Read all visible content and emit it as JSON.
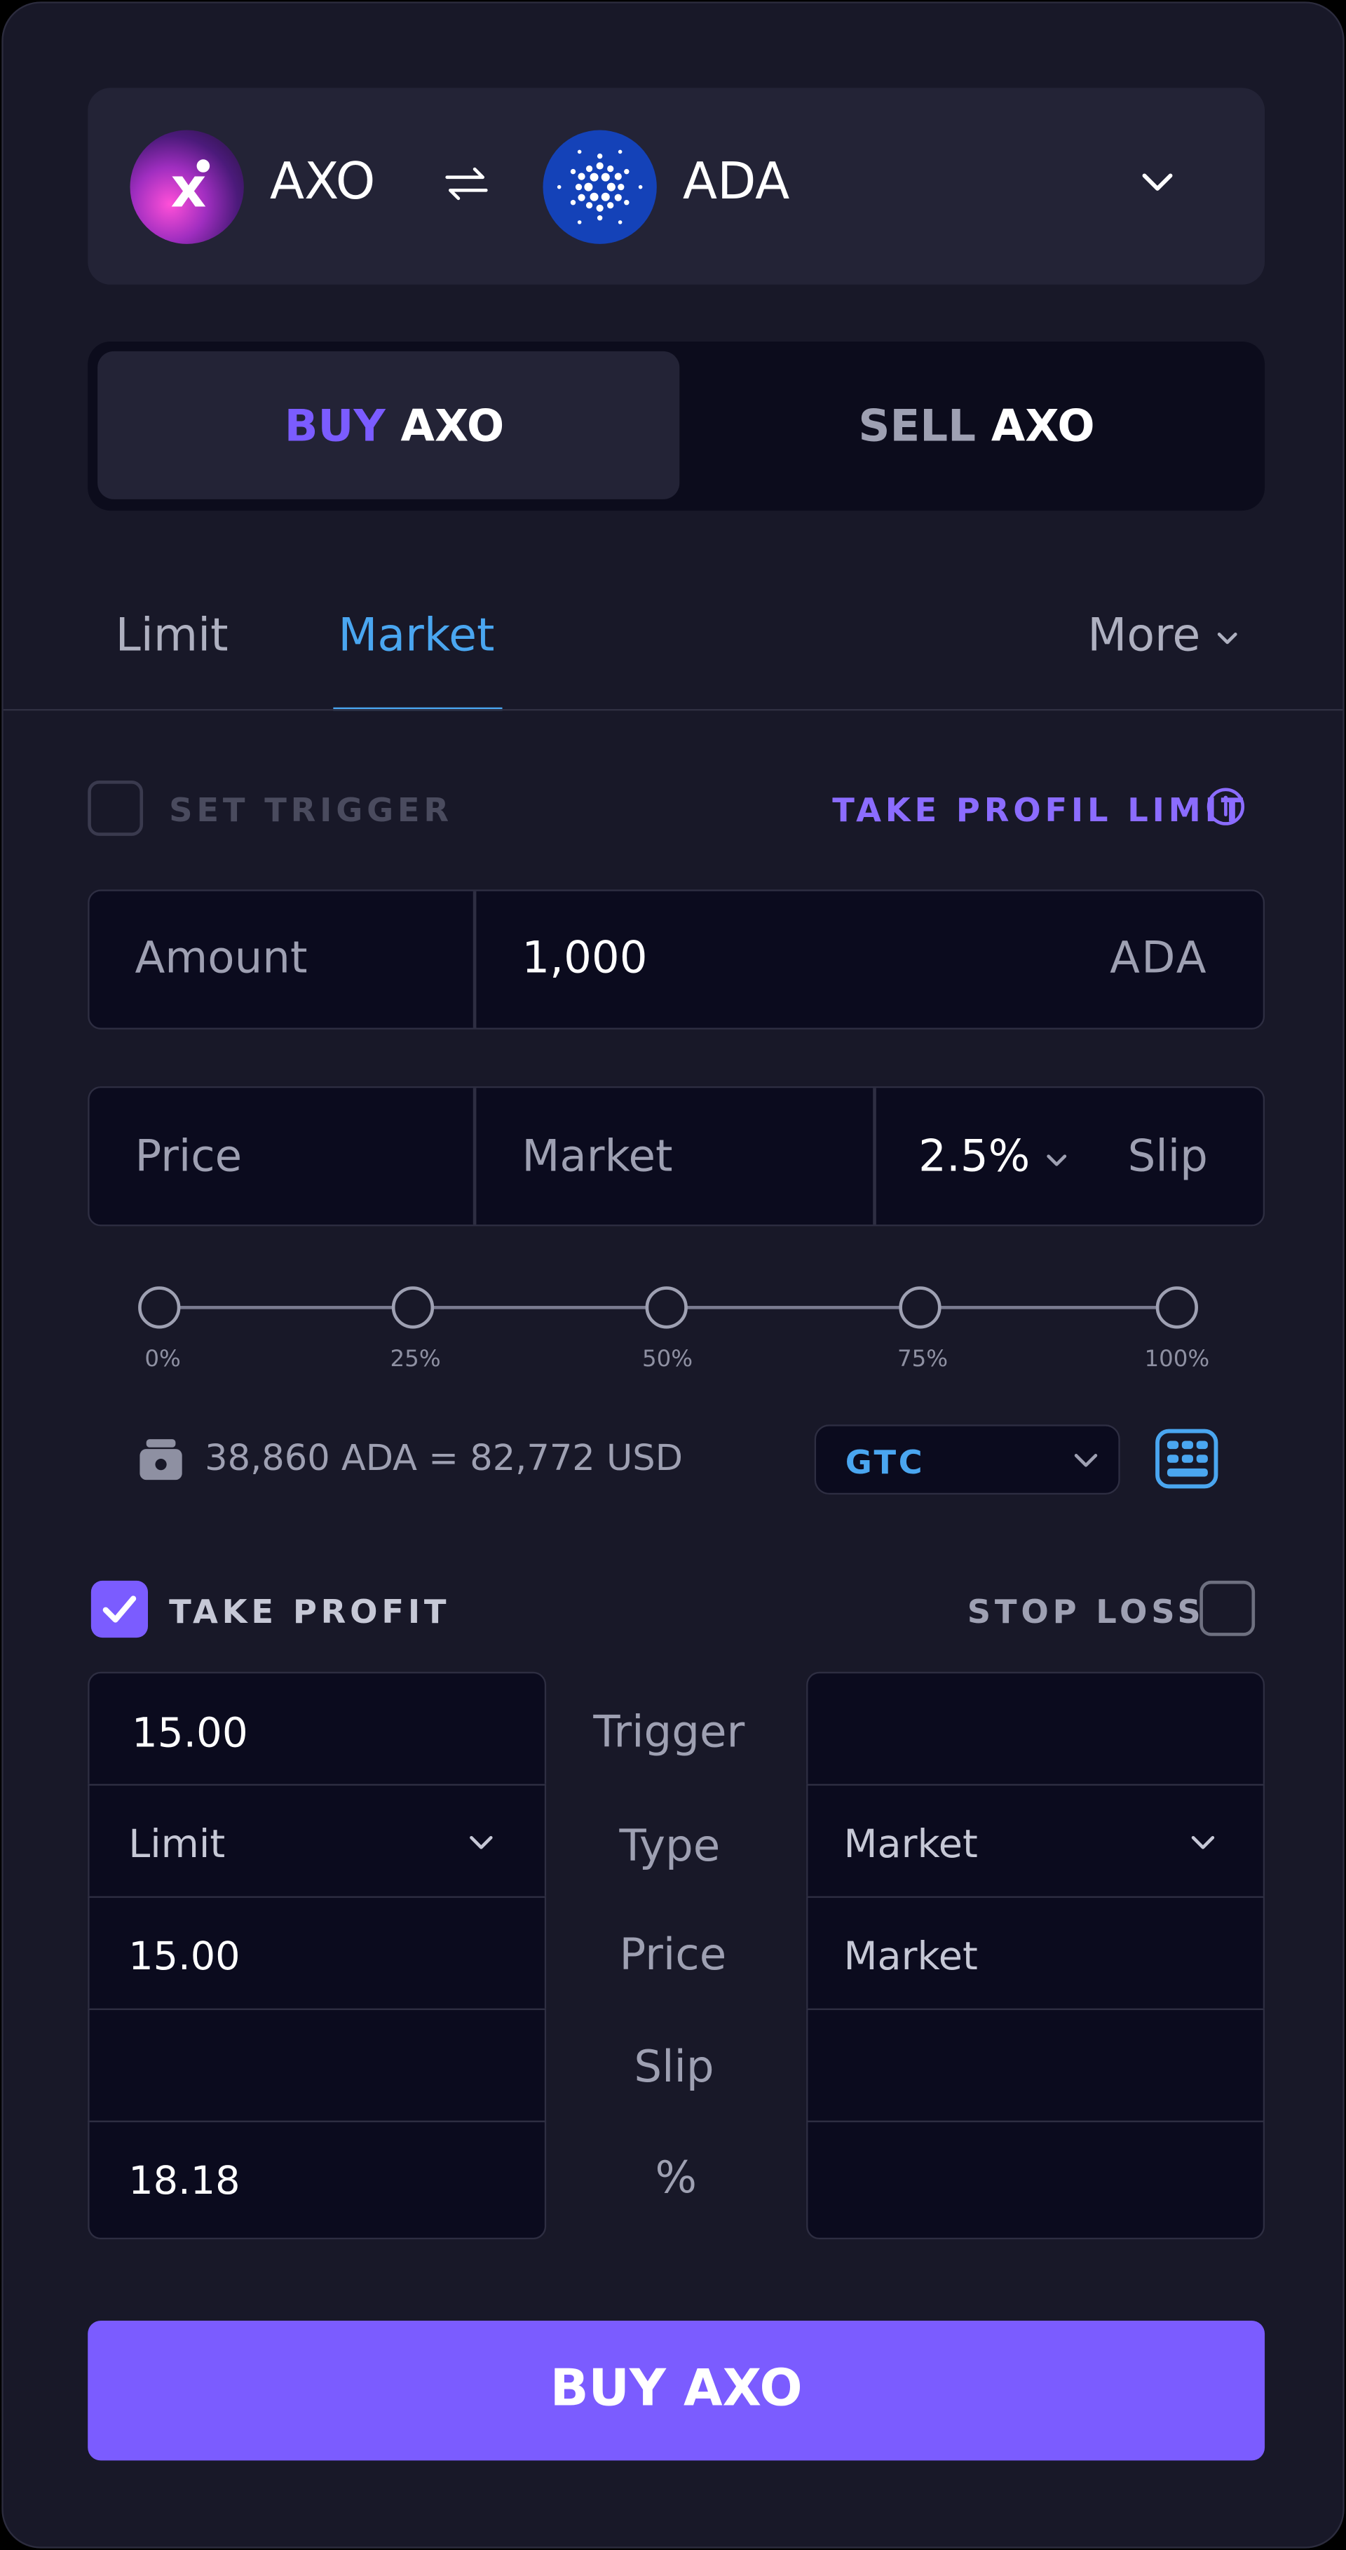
{
  "pair": {
    "base": "AXO",
    "quote": "ADA",
    "base_icon": "axo-logo-icon",
    "quote_icon": "cardano-logo-icon",
    "swap_icon": "swap-arrows-icon",
    "dropdown_icon": "chevron-down-icon"
  },
  "side_tabs": {
    "buy_prefix": "BUY",
    "buy_asset": "AXO",
    "sell_prefix": "SELL",
    "sell_asset": "AXO",
    "active": "buy"
  },
  "order_tabs": {
    "limit": "Limit",
    "market": "Market",
    "more": "More",
    "active": "market"
  },
  "trigger": {
    "set_trigger_label": "SET TRIGGER",
    "set_trigger_checked": false,
    "take_profit_limit_label": "TAKE PROFIL LIMIT"
  },
  "amount": {
    "label": "Amount",
    "value": "1,000",
    "unit": "ADA"
  },
  "price": {
    "label": "Price",
    "value": "Market",
    "slippage": "2.5%",
    "slip_label": "Slip"
  },
  "slider": {
    "ticks": [
      "0%",
      "25%",
      "50%",
      "75%",
      "100%"
    ],
    "value_percent": 0
  },
  "balance": {
    "text": "38,860 ADA = 82,772 USD",
    "time_in_force": "GTC"
  },
  "tp_sl": {
    "take_profit_label": "TAKE PROFIT",
    "take_profit_checked": true,
    "stop_loss_label": "STOP LOSS",
    "stop_loss_checked": false,
    "row_labels": [
      "Trigger",
      "Type",
      "Price",
      "Slip",
      "%"
    ],
    "take_profit": {
      "trigger": "15.00",
      "type": "Limit",
      "price": "15.00",
      "slip": "",
      "percent": "18.18"
    },
    "stop_loss": {
      "trigger": "",
      "type": "Market",
      "price": "Market",
      "slip": "",
      "percent": ""
    }
  },
  "submit": {
    "label": "BUY AXO"
  },
  "colors": {
    "accent_purple": "#7b5cff",
    "accent_blue": "#4aa6f0",
    "background": "#181828",
    "field": "#0b0b1e"
  }
}
